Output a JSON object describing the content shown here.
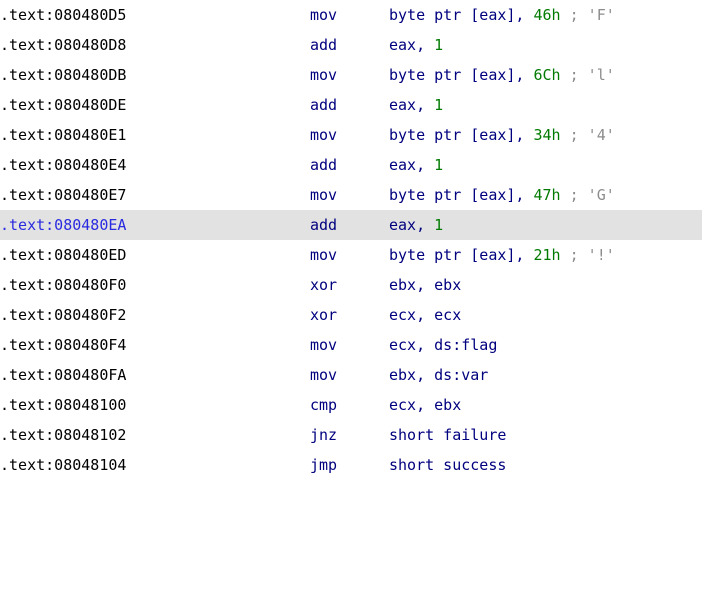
{
  "selected_index": 7,
  "colors": {
    "address": "#000000",
    "address_selected": "#2a2ae0",
    "selected_row_background": "#e2e2e2",
    "mnemonic": "#00007f",
    "operand": "#00007f",
    "immediate": "#007a00",
    "comment": "#8c8c8c"
  },
  "rows": [
    {
      "address": ".text:080480D5",
      "mnemonic": "mov",
      "operand_pre": "byte ptr [eax], ",
      "immediate": "46h",
      "comment": " ; 'F'"
    },
    {
      "address": ".text:080480D8",
      "mnemonic": "add",
      "operand_pre": "eax, ",
      "immediate": "1",
      "comment": ""
    },
    {
      "address": ".text:080480DB",
      "mnemonic": "mov",
      "operand_pre": "byte ptr [eax], ",
      "immediate": "6Ch",
      "comment": " ; 'l'"
    },
    {
      "address": ".text:080480DE",
      "mnemonic": "add",
      "operand_pre": "eax, ",
      "immediate": "1",
      "comment": ""
    },
    {
      "address": ".text:080480E1",
      "mnemonic": "mov",
      "operand_pre": "byte ptr [eax], ",
      "immediate": "34h",
      "comment": " ; '4'"
    },
    {
      "address": ".text:080480E4",
      "mnemonic": "add",
      "operand_pre": "eax, ",
      "immediate": "1",
      "comment": ""
    },
    {
      "address": ".text:080480E7",
      "mnemonic": "mov",
      "operand_pre": "byte ptr [eax], ",
      "immediate": "47h",
      "comment": " ; 'G'"
    },
    {
      "address": ".text:080480EA",
      "mnemonic": "add",
      "operand_pre": "eax, ",
      "immediate": "1",
      "comment": ""
    },
    {
      "address": ".text:080480ED",
      "mnemonic": "mov",
      "operand_pre": "byte ptr [eax], ",
      "immediate": "21h",
      "comment": " ; '!'"
    },
    {
      "address": ".text:080480F0",
      "mnemonic": "xor",
      "operand_pre": "ebx, ebx",
      "immediate": "",
      "comment": ""
    },
    {
      "address": ".text:080480F2",
      "mnemonic": "xor",
      "operand_pre": "ecx, ecx",
      "immediate": "",
      "comment": ""
    },
    {
      "address": ".text:080480F4",
      "mnemonic": "mov",
      "operand_pre": "ecx, ds:flag",
      "immediate": "",
      "comment": ""
    },
    {
      "address": ".text:080480FA",
      "mnemonic": "mov",
      "operand_pre": "ebx, ds:var",
      "immediate": "",
      "comment": ""
    },
    {
      "address": ".text:08048100",
      "mnemonic": "cmp",
      "operand_pre": "ecx, ebx",
      "immediate": "",
      "comment": ""
    },
    {
      "address": ".text:08048102",
      "mnemonic": "jnz",
      "operand_pre": "short failure",
      "immediate": "",
      "comment": ""
    },
    {
      "address": ".text:08048104",
      "mnemonic": "jmp",
      "operand_pre": "short success",
      "immediate": "",
      "comment": ""
    }
  ]
}
